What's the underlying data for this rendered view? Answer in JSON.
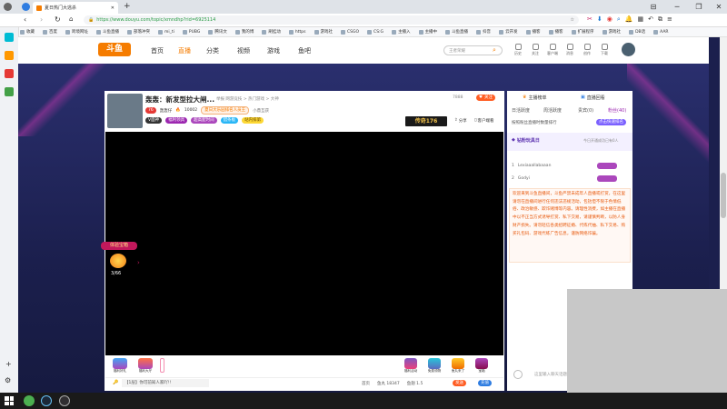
{
  "browser": {
    "tab_title": "夏日热门大逃杀",
    "url": "https://www.douyu.com/topic/xmndhp?rid=6925114",
    "bookmarks": [
      "收藏",
      "百度",
      "跨境网址",
      "斗鱼直播",
      "部落冲突",
      "mi_ti",
      "PUBG",
      "腾讯文",
      "我的博",
      "刷挂动",
      "https",
      "游戏社",
      "CSGO",
      "CS:G",
      "主播入",
      "主播中",
      "斗鱼直播",
      "抖音",
      "云开发",
      "播客",
      "播客",
      "扩展程序",
      "游戏社",
      "DB话",
      "AAR"
    ],
    "bookmark_count": 25
  },
  "site": {
    "logo": "斗鱼",
    "nav": [
      "首页",
      "直播",
      "分类",
      "视频",
      "游戏",
      "鱼吧"
    ],
    "search_placeholder": "王者荣耀",
    "header_icons": [
      "历史",
      "关注",
      "客户端",
      "消息",
      "创作",
      "下载"
    ]
  },
  "room": {
    "title": "轰轰：新发型拉大闸...",
    "breadcrumb": "举报  网游竞技 > 热门游戏 > 大神",
    "streamer_level": "76",
    "streamer_name": "轰轰仔",
    "hot_value": "10002",
    "rank_badge": "夏日大乐园排名人员王",
    "mini_badge": "小鼎互获",
    "follow_count": "7888",
    "follow_label": "关注",
    "tags": [
      "V面神",
      "福利领具",
      "超高配时间",
      "猎条板",
      "站内排第"
    ],
    "room_badge": "传奇176",
    "share_label": "分享",
    "client_label": "客户端看"
  },
  "treasure": {
    "label": "体验宝箱",
    "progress": "3/66"
  },
  "gift_bar": {
    "gifts": [
      "福利好礼",
      "福利大厅",
      "福利活动",
      "免费领物",
      "鱼丸来了",
      "宝箱"
    ],
    "danmu_prompt": "【1层】你可前知人家吖!!",
    "bottom_stats": [
      "首页",
      "鱼丸 18347",
      "鱼翅 1.5"
    ],
    "send_label": "发送",
    "recharge_label": "充值"
  },
  "side_panel": {
    "top_tabs": [
      "主播榜单",
      "直播回看"
    ],
    "sub_tabs": [
      "日活跃度",
      "周活跃度",
      "贵宾(0)",
      "粉丝(40)"
    ],
    "rank_notice": "按照粉丝直播时数量排行",
    "rank_button": "点击快速排名",
    "member_title": "钻粉玩具日",
    "member_note": "今日开通成功已有0人",
    "users": [
      {
        "rank": "1",
        "name": "Lexiaaallabaaan"
      },
      {
        "rank": "2",
        "name": "Godyi"
      }
    ],
    "notice": "欢迎来到斗鱼直播间，斗鱼严禁未成年人直播或打赏，在这里请勿在直播间进行任何违法违规活动，包括但不限于色情低俗、政治敏感、欺诈赌博等内容。请理性消费，如主播在直播中以不正当方式诱导打赏、私下交易，请谨慎判断，以防人身财产损失。请勿轻信各类招聘征婚、代练代抽、私下交易、购买礼包码、游戏代练广告信息，谨防网络诈骗。",
    "chat_placeholder": "这里输入聊天话题"
  }
}
